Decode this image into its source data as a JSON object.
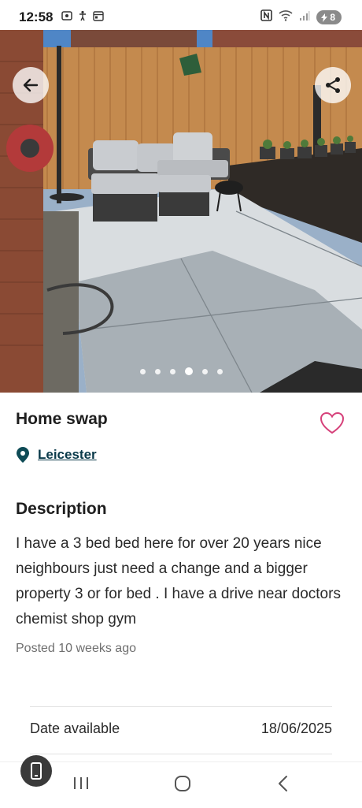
{
  "status_bar": {
    "time": "12:58",
    "battery": "8"
  },
  "gallery": {
    "dot_count": 6,
    "active_index": 3
  },
  "listing": {
    "title": "Home swap",
    "location": "Leicester",
    "description_heading": "Description",
    "description": "I have a 3 bed bed here for over 20 years nice neighbours  just need a change and a bigger property  3 or for bed . I have a drive  near doctors chemist  shop gym",
    "posted": "Posted 10 weeks ago"
  },
  "details": [
    {
      "label": "Date available",
      "value": "18/06/2025"
    }
  ],
  "icons": {
    "back": "arrow-left-icon",
    "share": "share-icon",
    "favourite": "heart-icon",
    "location": "map-pin-icon"
  },
  "colors": {
    "heart": "#d6417a",
    "location_link": "#0a3a4a",
    "pin": "#0e4b56"
  }
}
